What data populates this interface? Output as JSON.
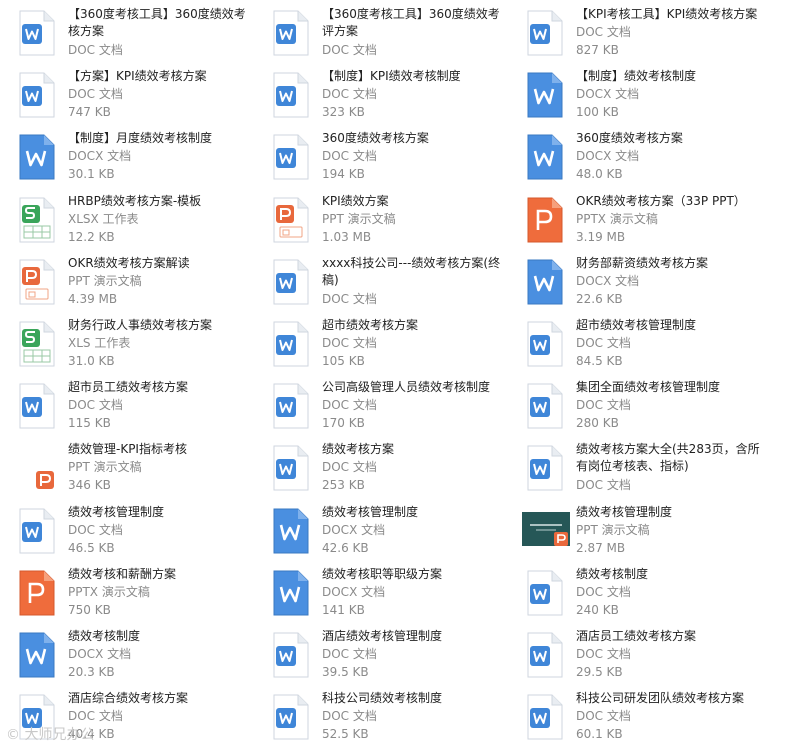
{
  "watermark": "© 大师兄办公",
  "files": [
    {
      "name": "【360度考核工具】360度绩效考核方案",
      "type": "DOC 文档",
      "size": "",
      "kind": "word"
    },
    {
      "name": "【360度考核工具】360度绩效考评方案",
      "type": "DOC 文档",
      "size": "",
      "kind": "word"
    },
    {
      "name": "【KPI考核工具】KPI绩效考核方案",
      "type": "DOC 文档",
      "size": "827 KB",
      "kind": "word"
    },
    {
      "name": "【方案】KPI绩效考核方案",
      "type": "DOC 文档",
      "size": "747 KB",
      "kind": "word"
    },
    {
      "name": "【制度】KPI绩效考核制度",
      "type": "DOC 文档",
      "size": "323 KB",
      "kind": "word"
    },
    {
      "name": "【制度】绩效考核制度",
      "type": "DOCX 文档",
      "size": "100 KB",
      "kind": "word-blue"
    },
    {
      "name": "【制度】月度绩效考核制度",
      "type": "DOCX 文档",
      "size": "30.1 KB",
      "kind": "word-blue"
    },
    {
      "name": "360度绩效考核方案",
      "type": "DOC 文档",
      "size": "194 KB",
      "kind": "word"
    },
    {
      "name": "360度绩效考核方案",
      "type": "DOCX 文档",
      "size": "48.0 KB",
      "kind": "word-blue"
    },
    {
      "name": "HRBP绩效考核方案-模板",
      "type": "XLSX 工作表",
      "size": "12.2 KB",
      "kind": "excel"
    },
    {
      "name": "KPI绩效方案",
      "type": "PPT 演示文稿",
      "size": "1.03 MB",
      "kind": "ppt"
    },
    {
      "name": "OKR绩效考核方案（33P PPT）",
      "type": "PPTX 演示文稿",
      "size": "3.19 MB",
      "kind": "ppt-orange"
    },
    {
      "name": "OKR绩效考核方案解读",
      "type": "PPT 演示文稿",
      "size": "4.39 MB",
      "kind": "ppt"
    },
    {
      "name": "xxxx科技公司---绩效考核方案(终稿)",
      "type": "DOC 文档",
      "size": "",
      "kind": "word"
    },
    {
      "name": "财务部薪资绩效考核方案",
      "type": "DOCX 文档",
      "size": "22.6 KB",
      "kind": "word-blue"
    },
    {
      "name": "财务行政人事绩效考核方案",
      "type": "XLS 工作表",
      "size": "31.0 KB",
      "kind": "excel"
    },
    {
      "name": "超市绩效考核方案",
      "type": "DOC 文档",
      "size": "105 KB",
      "kind": "word"
    },
    {
      "name": "超市绩效考核管理制度",
      "type": "DOC 文档",
      "size": "84.5 KB",
      "kind": "word"
    },
    {
      "name": "超市员工绩效考核方案",
      "type": "DOC 文档",
      "size": "115 KB",
      "kind": "word"
    },
    {
      "name": "公司高级管理人员绩效考核制度",
      "type": "DOC 文档",
      "size": "170 KB",
      "kind": "word"
    },
    {
      "name": "集团全面绩效考核管理制度",
      "type": "DOC 文档",
      "size": "280 KB",
      "kind": "word"
    },
    {
      "name": "绩效管理-KPI指标考核",
      "type": "PPT 演示文稿",
      "size": "346 KB",
      "kind": "ppt-badge"
    },
    {
      "name": "绩效考核方案",
      "type": "DOC 文档",
      "size": "253 KB",
      "kind": "word"
    },
    {
      "name": "绩效考核方案大全(共283页，含所有岗位考核表、指标)",
      "type": "DOC 文档",
      "size": "",
      "kind": "word"
    },
    {
      "name": "绩效考核管理制度",
      "type": "DOC 文档",
      "size": "46.5 KB",
      "kind": "word"
    },
    {
      "name": "绩效考核管理制度",
      "type": "DOCX 文档",
      "size": "42.6 KB",
      "kind": "word-blue"
    },
    {
      "name": "绩效考核管理制度",
      "type": "PPT 演示文稿",
      "size": "2.87 MB",
      "kind": "ppt-thumb"
    },
    {
      "name": "绩效考核和薪酬方案",
      "type": "PPTX 演示文稿",
      "size": "750 KB",
      "kind": "ppt-orange"
    },
    {
      "name": "绩效考核职等职级方案",
      "type": "DOCX 文档",
      "size": "141 KB",
      "kind": "word-blue"
    },
    {
      "name": "绩效考核制度",
      "type": "DOC 文档",
      "size": "240 KB",
      "kind": "word"
    },
    {
      "name": "绩效考核制度",
      "type": "DOCX 文档",
      "size": "20.3 KB",
      "kind": "word-blue"
    },
    {
      "name": "酒店绩效考核管理制度",
      "type": "DOC 文档",
      "size": "39.5 KB",
      "kind": "word"
    },
    {
      "name": "酒店员工绩效考核方案",
      "type": "DOC 文档",
      "size": "29.5 KB",
      "kind": "word"
    },
    {
      "name": "酒店综合绩效考核方案",
      "type": "DOC 文档",
      "size": "40.4 KB",
      "kind": "word"
    },
    {
      "name": "科技公司绩效考核制度",
      "type": "DOC 文档",
      "size": "52.5 KB",
      "kind": "word"
    },
    {
      "name": "科技公司研发团队绩效考核方案",
      "type": "DOC 文档",
      "size": "60.1 KB",
      "kind": "word"
    }
  ]
}
